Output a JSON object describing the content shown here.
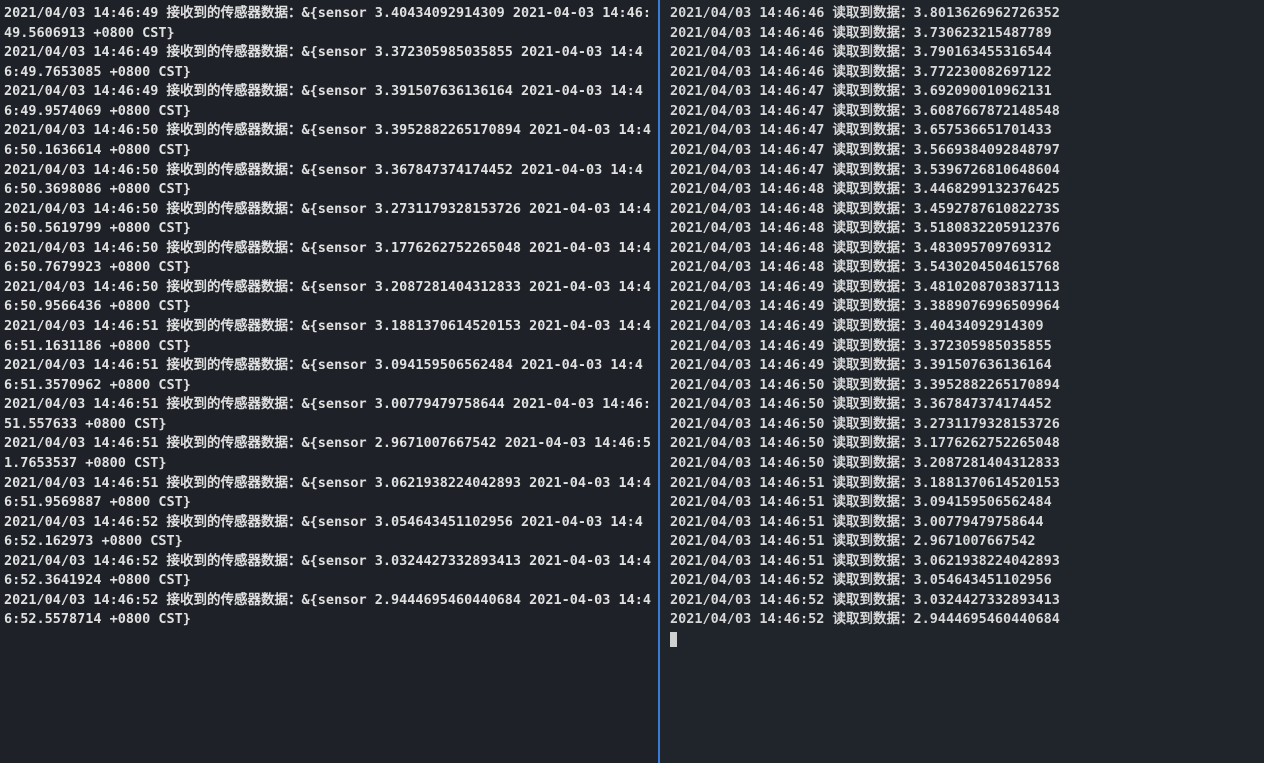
{
  "left_pane": {
    "lines": [
      "2021/04/03 14:46:49 接收到的传感器数据：&{sensor 3.40434092914309 2021-04-03 14:46:49.5606913 +0800 CST}",
      "2021/04/03 14:46:49 接收到的传感器数据：&{sensor 3.372305985035855 2021-04-03 14:46:49.7653085 +0800 CST}",
      "2021/04/03 14:46:49 接收到的传感器数据：&{sensor 3.391507636136164 2021-04-03 14:46:49.9574069 +0800 CST}",
      "2021/04/03 14:46:50 接收到的传感器数据：&{sensor 3.3952882265170894 2021-04-03 14:46:50.1636614 +0800 CST}",
      "2021/04/03 14:46:50 接收到的传感器数据：&{sensor 3.367847374174452 2021-04-03 14:46:50.3698086 +0800 CST}",
      "2021/04/03 14:46:50 接收到的传感器数据：&{sensor 3.2731179328153726 2021-04-03 14:46:50.5619799 +0800 CST}",
      "2021/04/03 14:46:50 接收到的传感器数据：&{sensor 3.1776262752265048 2021-04-03 14:46:50.7679923 +0800 CST}",
      "2021/04/03 14:46:50 接收到的传感器数据：&{sensor 3.2087281404312833 2021-04-03 14:46:50.9566436 +0800 CST}",
      "2021/04/03 14:46:51 接收到的传感器数据：&{sensor 3.1881370614520153 2021-04-03 14:46:51.1631186 +0800 CST}",
      "2021/04/03 14:46:51 接收到的传感器数据：&{sensor 3.094159506562484 2021-04-03 14:46:51.3570962 +0800 CST}",
      "2021/04/03 14:46:51 接收到的传感器数据：&{sensor 3.00779479758644 2021-04-03 14:46:51.557633 +0800 CST}",
      "2021/04/03 14:46:51 接收到的传感器数据：&{sensor 2.9671007667542 2021-04-03 14:46:51.7653537 +0800 CST}",
      "2021/04/03 14:46:51 接收到的传感器数据：&{sensor 3.0621938224042893 2021-04-03 14:46:51.9569887 +0800 CST}",
      "2021/04/03 14:46:52 接收到的传感器数据：&{sensor 3.054643451102956 2021-04-03 14:46:52.162973 +0800 CST}",
      "2021/04/03 14:46:52 接收到的传感器数据：&{sensor 3.0324427332893413 2021-04-03 14:46:52.3641924 +0800 CST}",
      "2021/04/03 14:46:52 接收到的传感器数据：&{sensor 2.9444695460440684 2021-04-03 14:46:52.5578714 +0800 CST}"
    ]
  },
  "right_pane": {
    "lines": [
      "2021/04/03 14:46:46 读取到数据：3.8013626962726352",
      "2021/04/03 14:46:46 读取到数据：3.730623215487789",
      "2021/04/03 14:46:46 读取到数据：3.790163455316544",
      "2021/04/03 14:46:46 读取到数据：3.772230082697122",
      "2021/04/03 14:46:47 读取到数据：3.692090010962131",
      "2021/04/03 14:46:47 读取到数据：3.6087667872148548",
      "2021/04/03 14:46:47 读取到数据：3.657536651701433",
      "2021/04/03 14:46:47 读取到数据：3.5669384092848797",
      "2021/04/03 14:46:47 读取到数据：3.5396726810648604",
      "2021/04/03 14:46:48 读取到数据：3.4468299132376425",
      "2021/04/03 14:46:48 读取到数据：3.459278761082273S",
      "2021/04/03 14:46:48 读取到数据：3.5180832205912376",
      "2021/04/03 14:46:48 读取到数据：3.483095709769312",
      "2021/04/03 14:46:48 读取到数据：3.5430204504615768",
      "2021/04/03 14:46:49 读取到数据：3.4810208703837113",
      "2021/04/03 14:46:49 读取到数据：3.3889076996509964",
      "2021/04/03 14:46:49 读取到数据：3.40434092914309",
      "2021/04/03 14:46:49 读取到数据：3.372305985035855",
      "2021/04/03 14:46:49 读取到数据：3.391507636136164",
      "2021/04/03 14:46:50 读取到数据：3.3952882265170894",
      "2021/04/03 14:46:50 读取到数据：3.367847374174452",
      "2021/04/03 14:46:50 读取到数据：3.2731179328153726",
      "2021/04/03 14:46:50 读取到数据：3.1776262752265048",
      "2021/04/03 14:46:50 读取到数据：3.2087281404312833",
      "2021/04/03 14:46:51 读取到数据：3.1881370614520153",
      "2021/04/03 14:46:51 读取到数据：3.094159506562484",
      "2021/04/03 14:46:51 读取到数据：3.00779479758644",
      "2021/04/03 14:46:51 读取到数据：2.9671007667542",
      "2021/04/03 14:46:51 读取到数据：3.0621938224042893",
      "2021/04/03 14:46:52 读取到数据：3.054643451102956",
      "2021/04/03 14:46:52 读取到数据：3.0324427332893413",
      "2021/04/03 14:46:52 读取到数据：2.9444695460440684"
    ]
  }
}
